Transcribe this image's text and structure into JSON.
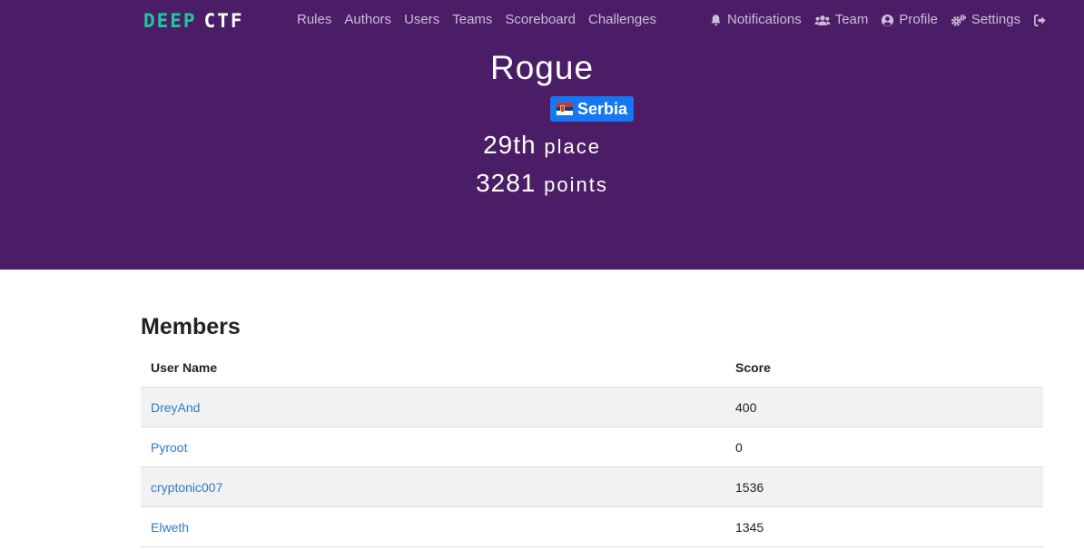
{
  "brand": {
    "part1": "DEEP",
    "part2": "CTF"
  },
  "nav": {
    "left": [
      "Rules",
      "Authors",
      "Users",
      "Teams",
      "Scoreboard",
      "Challenges"
    ],
    "notifications": "Notifications",
    "team": "Team",
    "profile": "Profile",
    "settings": "Settings"
  },
  "team": {
    "name": "Rogue",
    "country": "Serbia",
    "place_value": "29th",
    "place_label": "place",
    "points_value": "3281",
    "points_label": "points"
  },
  "members": {
    "title": "Members",
    "headers": [
      "User Name",
      "Score"
    ],
    "rows": [
      {
        "name": "DreyAnd",
        "score": "400"
      },
      {
        "name": "Pyroot",
        "score": "0"
      },
      {
        "name": "cryptonic007",
        "score": "1536"
      },
      {
        "name": "Elweth",
        "score": "1345"
      }
    ]
  },
  "colors": {
    "hero": "#4b1d66",
    "accent": "#1ec9a0",
    "badge": "#1677f2",
    "link": "#2f7ac3"
  }
}
